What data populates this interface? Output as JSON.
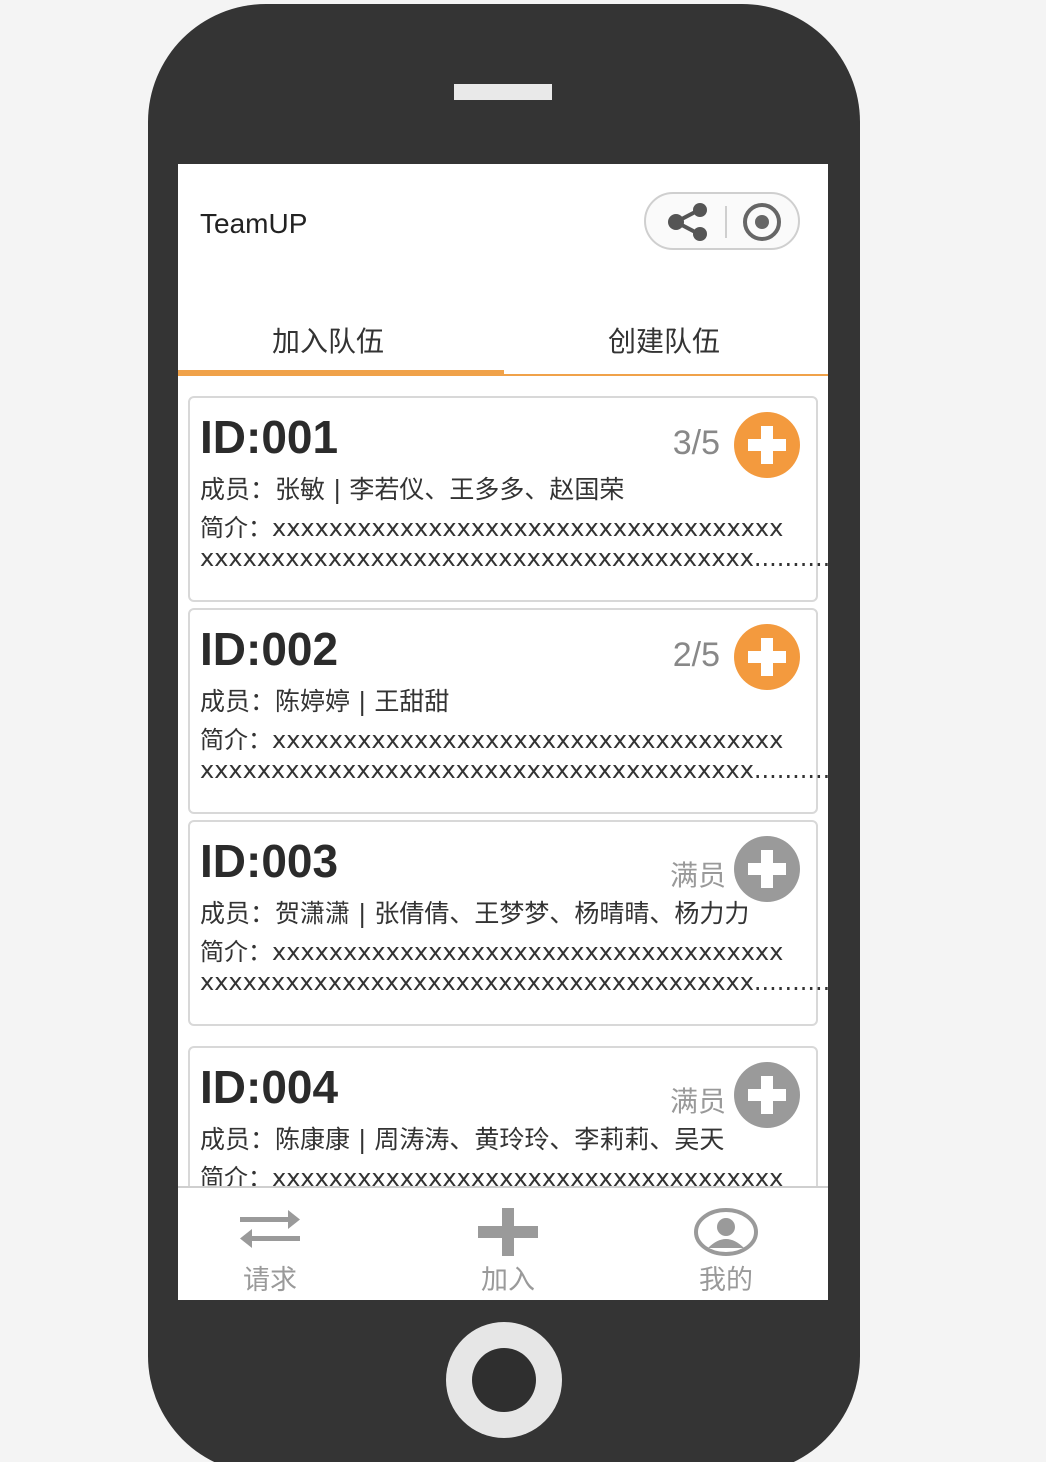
{
  "app": {
    "title": "TeamUP"
  },
  "tabs": [
    {
      "label": "加入队伍",
      "active": true
    },
    {
      "label": "创建队伍",
      "active": false
    }
  ],
  "teams": [
    {
      "id": "ID:001",
      "capacity": "3/5",
      "full": false,
      "members": "成员：张敏 | 李若仪、王多多、赵国荣",
      "intro_line1": "简介：xxxxxxxxxxxxxxxxxxxxxxxxxxxxxxxxxxxx",
      "intro_line2": "xxxxxxxxxxxxxxxxxxxxxxxxxxxxxxxxxxxxxxx............"
    },
    {
      "id": "ID:002",
      "capacity": "2/5",
      "full": false,
      "members": "成员：陈婷婷 | 王甜甜",
      "intro_line1": "简介：xxxxxxxxxxxxxxxxxxxxxxxxxxxxxxxxxxxx",
      "intro_line2": "xxxxxxxxxxxxxxxxxxxxxxxxxxxxxxxxxxxxxxx............"
    },
    {
      "id": "ID:003",
      "capacity": "满员",
      "full": true,
      "members": "成员：贺潇潇 | 张倩倩、王梦梦、杨晴晴、杨力力",
      "intro_line1": "简介：xxxxxxxxxxxxxxxxxxxxxxxxxxxxxxxxxxxx",
      "intro_line2": "xxxxxxxxxxxxxxxxxxxxxxxxxxxxxxxxxxxxxxx............"
    },
    {
      "id": "ID:004",
      "capacity": "满员",
      "full": true,
      "members": "成员：陈康康 | 周涛涛、黄玲玲、李莉莉、吴天",
      "intro_line1": "简介：xxxxxxxxxxxxxxxxxxxxxxxxxxxxxxxxxxxx",
      "intro_line2": ""
    }
  ],
  "bottom_nav": [
    {
      "label": "请求",
      "icon": "swap-arrows-icon"
    },
    {
      "label": "加入",
      "icon": "plus-icon"
    },
    {
      "label": "我的",
      "icon": "user-icon"
    }
  ],
  "colors": {
    "accent": "#f39a3e",
    "disabled": "#9a9a9a",
    "frame": "#343434"
  }
}
